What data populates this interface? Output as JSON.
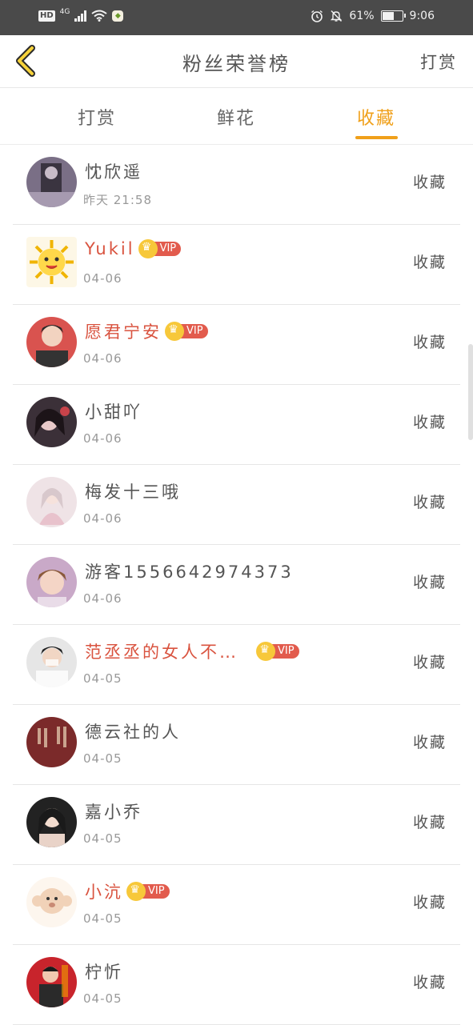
{
  "status": {
    "hd": "HD",
    "net": "4G",
    "battery_percent": "61%",
    "battery_level": 0.61,
    "time": "9:06",
    "icons": [
      "signal-icon",
      "wifi-icon",
      "app-notification-icon",
      "alarm-icon",
      "mute-icon",
      "battery-icon"
    ]
  },
  "header": {
    "title": "粉丝荣誉榜",
    "right_action": "打赏",
    "back_icon": "chevron-left-icon",
    "accent_color": "#f0a01a"
  },
  "tabs": [
    {
      "label": "打赏",
      "active": false
    },
    {
      "label": "鲜花",
      "active": false
    },
    {
      "label": "收藏",
      "active": true
    }
  ],
  "vip_label": "VIP",
  "fans": [
    {
      "name": "忱欣遥",
      "time": "昨天 21:58",
      "action": "收藏",
      "vip": false
    },
    {
      "name": "Yukil",
      "time": "04-06",
      "action": "收藏",
      "vip": true
    },
    {
      "name": "愿君宁安",
      "time": "04-06",
      "action": "收藏",
      "vip": true
    },
    {
      "name": "小甜吖",
      "time": "04-06",
      "action": "收藏",
      "vip": false
    },
    {
      "name": "梅发十三哦",
      "time": "04-06",
      "action": "收藏",
      "vip": false
    },
    {
      "name": "游客1556642974373",
      "time": "04-06",
      "action": "收藏",
      "vip": false
    },
    {
      "name": "范丞丞的女人不…",
      "time": "04-05",
      "action": "收藏",
      "vip": true
    },
    {
      "name": "德云社的人",
      "time": "04-05",
      "action": "收藏",
      "vip": false
    },
    {
      "name": "嘉小乔",
      "time": "04-05",
      "action": "收藏",
      "vip": false
    },
    {
      "name": "小沆",
      "time": "04-05",
      "action": "收藏",
      "vip": true
    },
    {
      "name": "柠忻",
      "time": "04-05",
      "action": "收藏",
      "vip": false
    }
  ]
}
